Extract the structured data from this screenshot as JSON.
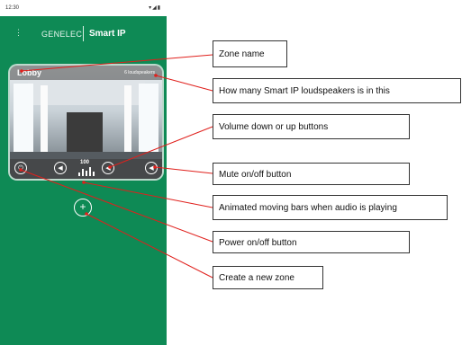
{
  "status": {
    "time": "12:30",
    "icons": "▾◢▮"
  },
  "appbar": {
    "menu_icon": "⋮",
    "brand": "GENELEC",
    "title": "Smart IP"
  },
  "zone": {
    "name": "Lobby",
    "speaker_count": "6 loudspeakers",
    "volume": "100",
    "power_icon": "⏻",
    "volume_down_icon": "◀",
    "volume_up_icon": "◀",
    "mute_icon": "◀",
    "bars_levels": [
      0.4,
      0.8,
      0.6,
      1.0,
      0.5
    ]
  },
  "add_zone": {
    "icon": "+"
  },
  "callouts": {
    "zone_name": "Zone name",
    "speaker_count": "How many Smart IP loudspeakers is in this",
    "volume": "Volume down or up buttons",
    "mute": "Mute on/off button",
    "bars": "Animated moving bars when audio is playing",
    "power": "Power on/off button",
    "create": "Create a new zone"
  },
  "colors": {
    "app_green": "#0e8a55",
    "callout_line": "#e0201c"
  }
}
